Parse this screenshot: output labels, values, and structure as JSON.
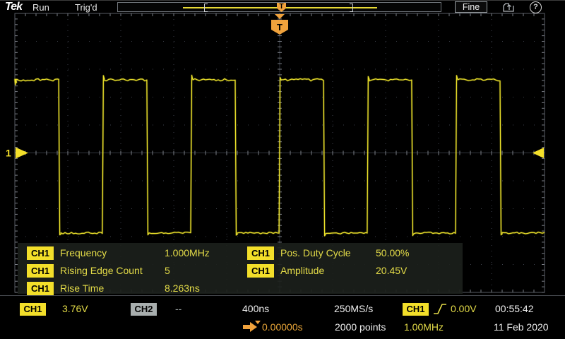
{
  "top_bar": {
    "logo": "Tek",
    "acq_state": "Run",
    "trigger_state": "Trig'd",
    "fine_button": "Fine",
    "trigger_marker_letter": "T",
    "icons": {
      "save_icon": "file-save-export",
      "help_icon": "?",
      "acquisition_preview": "record-view-brackets"
    }
  },
  "display": {
    "channel_marker_label": "1",
    "trigger_flag_letter": "T",
    "colors": {
      "waveform_yellow": "#ede32b",
      "ch1_yellow": "#f3df2a",
      "ch2_gray": "#a8aeae",
      "orange_accent": "#f0a23c",
      "grid_dot": "#3d414b",
      "grid_tick": "#7a7e86",
      "grid_border": "#575b63"
    }
  },
  "measurements": {
    "left": [
      {
        "channel": "CH1",
        "label": "Frequency",
        "value": "1.000MHz"
      },
      {
        "channel": "CH1",
        "label": "Rising Edge Count",
        "value": "5"
      },
      {
        "channel": "CH1",
        "label": "Rise Time",
        "value": "8.263ns"
      }
    ],
    "right": [
      {
        "channel": "CH1",
        "label": "Pos. Duty Cycle",
        "value": "50.00%"
      },
      {
        "channel": "CH1",
        "label": "Amplitude",
        "value": "20.45V"
      }
    ]
  },
  "status_bar": {
    "ch1_label": "CH1",
    "ch1_scale": "3.76V",
    "ch2_label": "CH2",
    "ch2_scale": "--",
    "timebase": "400ns",
    "sample_rate": "250MS/s",
    "trigger_source": "CH1",
    "trigger_slope_icon": "rising-edge",
    "trigger_level": "0.00V",
    "clock_time": "00:55:42",
    "horizontal_position": "0.00000s",
    "record_length": "2000 points",
    "trigger_frequency": "1.00MHz",
    "date": "11 Feb 2020"
  },
  "chart_data": {
    "type": "line",
    "title": "CH1 square wave",
    "x_unit": "ns",
    "t_start_ns": -2000,
    "t_end_ns": 2000,
    "time_per_div_ns": 400,
    "volts_per_div": 3.76,
    "high_v": 9.85,
    "low_v": -10.8,
    "initial_state": "high",
    "transitions_ns": [
      -1669,
      -1339,
      -1003,
      -672,
      -336,
      -5,
      331,
      661,
      997,
      1328,
      1664
    ],
    "rising_edge_count": 5,
    "grid": "10x10 divisions, dotted",
    "trigger_level_v": 0.0,
    "trigger_position_ns": 0
  }
}
